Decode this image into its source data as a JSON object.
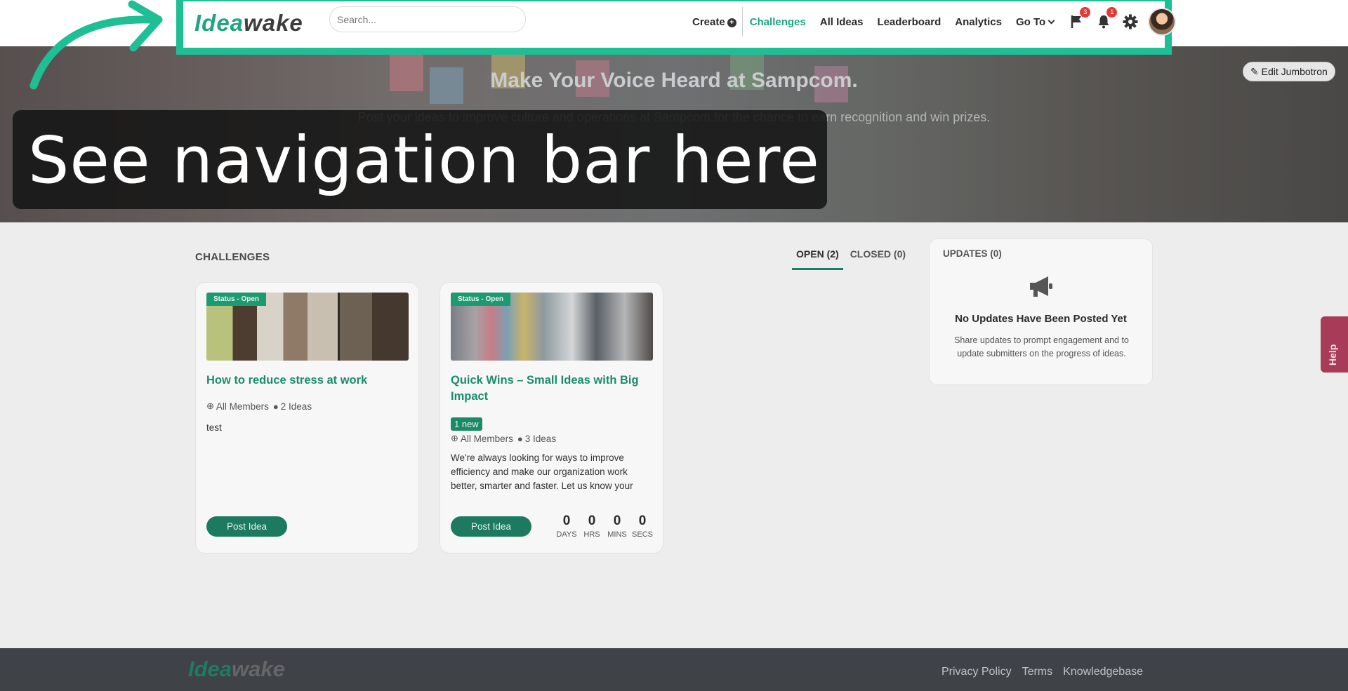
{
  "navbar": {
    "logo_part1": "Idea",
    "logo_part2": "wake",
    "search_placeholder": "Search...",
    "links": {
      "create": "Create",
      "challenges": "Challenges",
      "all_ideas": "All Ideas",
      "leaderboard": "Leaderboard",
      "analytics": "Analytics",
      "go_to": "Go To"
    },
    "flag_badge": "3",
    "bell_badge": "1",
    "accent_color": "#1fa584",
    "highlight_color": "#1fbf95"
  },
  "hero": {
    "title": "Make Your Voice Heard at Sampcom.",
    "subtitle": "Post your ideas to improve culture and operations at Sampcom for the chance to earn recognition and win prizes.",
    "edit_button": "Edit Jumbotron"
  },
  "overlay": {
    "caption": "See navigation bar here"
  },
  "challenges": {
    "heading": "CHALLENGES",
    "tabs": {
      "open": "OPEN (2)",
      "closed": "CLOSED (0)"
    },
    "cards": [
      {
        "status": "Status - Open",
        "title": "How to reduce stress at work",
        "audience": "All Members",
        "ideas": "2 Ideas",
        "description": "test",
        "post_button": "Post Idea"
      },
      {
        "status": "Status - Open",
        "title": "Quick Wins – Small Ideas with Big Impact",
        "new_badge": "1 new",
        "audience": "All Members",
        "ideas": "3 Ideas",
        "description": "We're always looking for ways to improve efficiency and make our organization work better, smarter and faster. Let us know your small ideas that you feel could have a big",
        "post_button": "Post Idea",
        "countdown": {
          "days": "0",
          "days_label": "DAYS",
          "hrs": "0",
          "hrs_label": "HRS",
          "mins": "0",
          "mins_label": "MINS",
          "secs": "0",
          "secs_label": "SECS"
        }
      }
    ]
  },
  "updates": {
    "title": "UPDATES (0)",
    "heading": "No Updates Have Been Posted Yet",
    "text": "Share updates to prompt engagement and to update submitters on the progress of ideas."
  },
  "help": {
    "label": "Help"
  },
  "footer": {
    "logo_part1": "Idea",
    "logo_part2": "wake",
    "links": [
      "Privacy Policy",
      "Terms",
      "Knowledgebase"
    ]
  }
}
